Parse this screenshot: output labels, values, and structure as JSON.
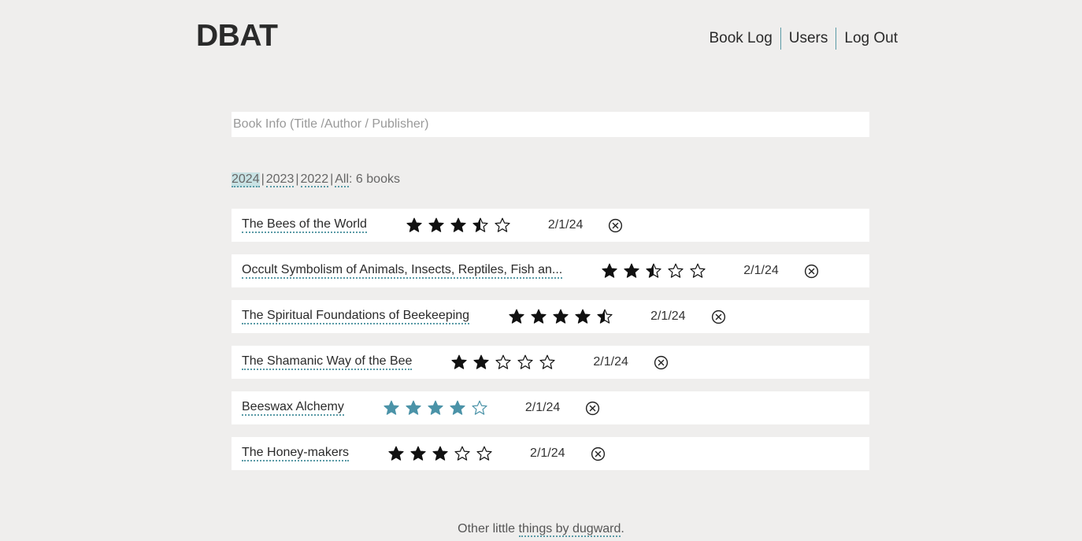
{
  "header": {
    "logo": "DBAT",
    "nav": [
      "Book Log",
      "Users",
      "Log Out"
    ]
  },
  "search": {
    "placeholder": "Book Info (Title /Author / Publisher)",
    "value": ""
  },
  "years": {
    "items": [
      "2024",
      "2023",
      "2022"
    ],
    "active": "2024",
    "all_label": "All",
    "count_text": ": 6 books"
  },
  "books": [
    {
      "title": "The Bees of the World",
      "rating": 3.5,
      "date": "2/1/24",
      "highlight": false
    },
    {
      "title": "Occult Symbolism of Animals, Insects, Reptiles, Fish an...",
      "rating": 2.5,
      "date": "2/1/24",
      "highlight": false
    },
    {
      "title": "The Spiritual Foundations of Beekeeping",
      "rating": 4.5,
      "date": "2/1/24",
      "highlight": false
    },
    {
      "title": "The Shamanic Way of the Bee",
      "rating": 2,
      "date": "2/1/24",
      "highlight": false
    },
    {
      "title": "Beeswax Alchemy",
      "rating": 4,
      "date": "2/1/24",
      "highlight": true
    },
    {
      "title": "The Honey-makers",
      "rating": 3,
      "date": "2/1/24",
      "highlight": false
    }
  ],
  "footer": {
    "prefix": "Other little ",
    "link": "things by dugward",
    "suffix": "."
  },
  "colors": {
    "accent": "#5a9aa6",
    "star": "#111111",
    "star_hover": "#4b93a8",
    "active_year_bg": "#c8e2e4"
  }
}
